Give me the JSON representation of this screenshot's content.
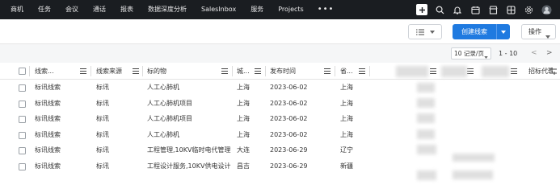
{
  "topnav": {
    "items": [
      "商机",
      "任务",
      "会议",
      "通话",
      "报表",
      "数据深度分析",
      "SalesInbox",
      "服务",
      "Projects"
    ],
    "more_label": "•••",
    "icons": [
      "add-icon",
      "search-icon",
      "bell-icon",
      "calendar-icon",
      "store-icon",
      "grid-icon",
      "settings-icon",
      "avatar-icon"
    ]
  },
  "toolbar": {
    "create_label": "创建线索",
    "ops_label": "操作"
  },
  "pagination": {
    "per_page": "10 记录/页",
    "range": "1 - 10",
    "prev": "<",
    "next": ">"
  },
  "table": {
    "headers": [
      "线索...",
      "线索来源",
      "标的物",
      "城...",
      "发布时间",
      "省...",
      "招标代理机构"
    ],
    "rows": [
      [
        "标讯线索",
        "标讯",
        "人工心肺机",
        "上海",
        "2023-06-02",
        "上海"
      ],
      [
        "标讯线索",
        "标讯",
        "人工心肺机项目",
        "上海",
        "2023-06-02",
        "上海"
      ],
      [
        "标讯线索",
        "标讯",
        "人工心肺机项目",
        "上海",
        "2023-06-02",
        "上海"
      ],
      [
        "标讯线索",
        "标讯",
        "人工心肺机",
        "上海",
        "2023-06-02",
        "上海"
      ],
      [
        "标讯线索",
        "标讯",
        "工程管理,10KV临时电代管理",
        "大连",
        "2023-06-29",
        "辽宁"
      ],
      [
        "标讯线索",
        "标讯",
        "工程设计服务,10KV供电设计",
        "昌吉",
        "2023-06-29",
        "新疆"
      ]
    ]
  }
}
